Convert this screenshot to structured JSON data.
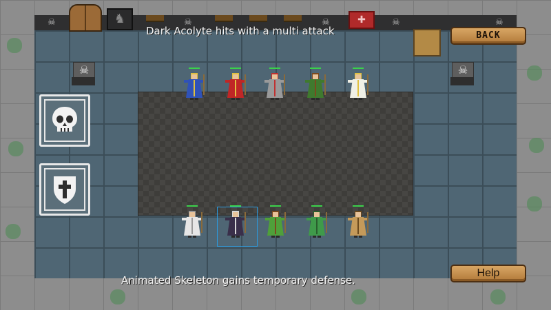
{
  "combat_log": {
    "top_message": "Dark Acolyte hits with a multi attack",
    "bottom_message": "Animated Skeleton gains temporary defense."
  },
  "buttons": {
    "back_label": "BACK",
    "help_label": "Help"
  },
  "skills": [
    {
      "name": "skull-skill",
      "icon": "skull-icon"
    },
    {
      "name": "shield-skill",
      "icon": "shield-cross-icon"
    }
  ],
  "enemy_party": [
    {
      "id": "blue-mage",
      "robe": "#2f52b8",
      "trim": "#e0c040"
    },
    {
      "id": "red-mage",
      "robe": "#c02626",
      "trim": "#e0c040"
    },
    {
      "id": "knight",
      "robe": "#9a9a9a",
      "trim": "#c03030"
    },
    {
      "id": "ranger",
      "robe": "#3f7a2e",
      "trim": "#7a4a1e"
    },
    {
      "id": "priest",
      "robe": "#f0f0e6",
      "trim": "#e0c040"
    }
  ],
  "player_party": [
    {
      "id": "animated-skeleton",
      "body": "#e6e6e6",
      "trim": "#9a9a9a"
    },
    {
      "id": "dark-acolyte",
      "body": "#3a2f4a",
      "trim": "#d8d8d8",
      "selected": true
    },
    {
      "id": "goblin",
      "body": "#4fa03a",
      "trim": "#7a4a1e"
    },
    {
      "id": "orc",
      "body": "#3f9a4a",
      "trim": "#2a5e2e"
    },
    {
      "id": "ogre",
      "body": "#c49a5a",
      "trim": "#6b4a1e"
    }
  ],
  "colors": {
    "selection": "#2b9be0",
    "hp_bar": "#3bd24b",
    "wood_button": "#c89050"
  }
}
